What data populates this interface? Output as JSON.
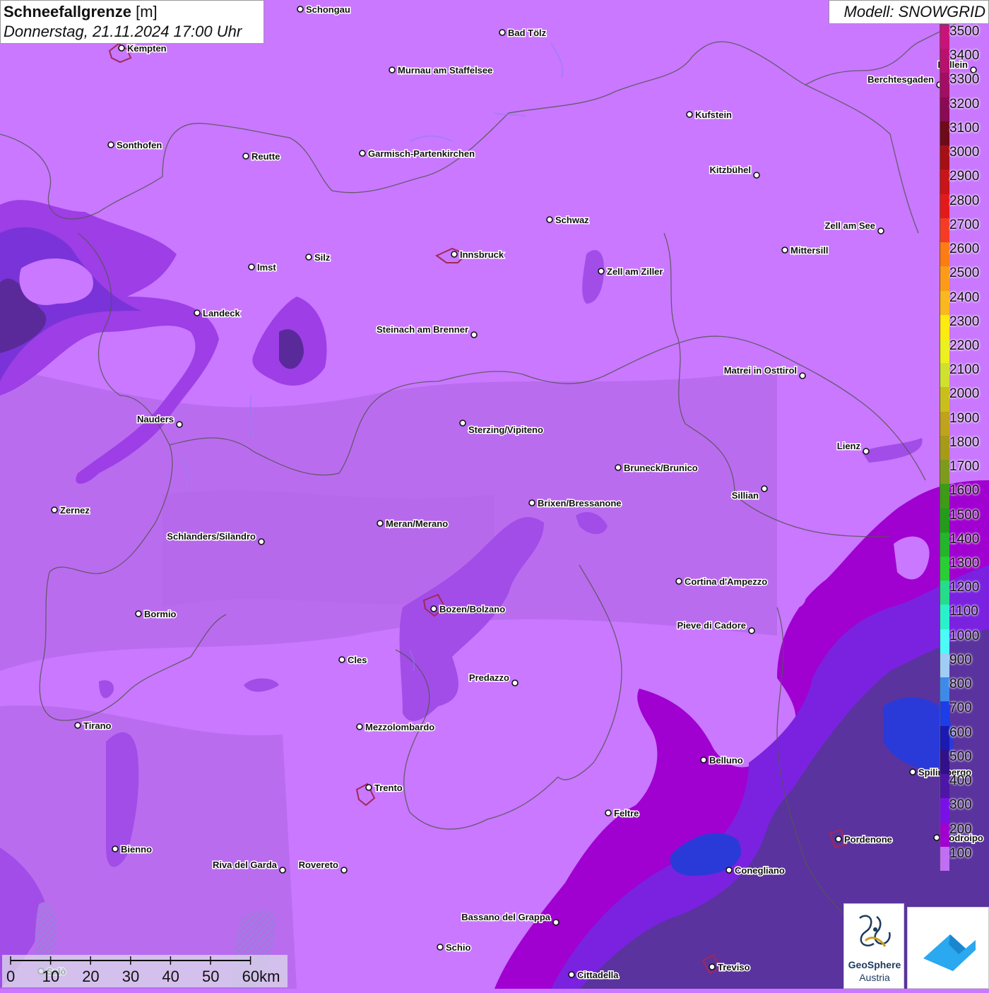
{
  "header": {
    "title_bold": "Schneefallgrenze",
    "title_unit": "[m]",
    "datetime": "Donnerstag, 21.11.2024 17:00 Uhr"
  },
  "model_label": "Modell: SNOWGRID",
  "legend": {
    "labels": [
      "3500",
      "3400",
      "3300",
      "3200",
      "3100",
      "3000",
      "2900",
      "2800",
      "2700",
      "2600",
      "2500",
      "2400",
      "2300",
      "2200",
      "2100",
      "2000",
      "1900",
      "1800",
      "1700",
      "1600",
      "1500",
      "1400",
      "1300",
      "1200",
      "1100",
      "1000",
      "900",
      "800",
      "700",
      "600",
      "500",
      "400",
      "300",
      "200",
      "100"
    ],
    "colors": [
      "#c8137a",
      "#b8116e",
      "#a30d63",
      "#8a0a55",
      "#6e0a1a",
      "#a50f15",
      "#c8141b",
      "#e31a1c",
      "#f53b25",
      "#fe7c14",
      "#fd9a1a",
      "#fbb71e",
      "#fdea10",
      "#ecf01e",
      "#cfe02e",
      "#c9be1c",
      "#c0a21c",
      "#a69a18",
      "#7e9a1c",
      "#3d9b15",
      "#239b1b",
      "#23b52b",
      "#29cd34",
      "#25dc8a",
      "#2af0cc",
      "#4dfafa",
      "#9fcdf5",
      "#3f8ae8",
      "#1c3de8",
      "#1a1ab2",
      "#32108a",
      "#4d16a6",
      "#7a10e8",
      "#a000d0",
      "#c06ef5"
    ]
  },
  "cities": [
    {
      "name": "Schongau"
    },
    {
      "name": "Bad Tölz"
    },
    {
      "name": "Kempten"
    },
    {
      "name": "Murnau am Staffelsee"
    },
    {
      "name": "Hallein"
    },
    {
      "name": "Berchtesgaden"
    },
    {
      "name": "Kufstein"
    },
    {
      "name": "Sonthofen"
    },
    {
      "name": "Reutte"
    },
    {
      "name": "Garmisch-Partenkirchen"
    },
    {
      "name": "Kitzbühel"
    },
    {
      "name": "Schwaz"
    },
    {
      "name": "Zell am See"
    },
    {
      "name": "Innsbruck"
    },
    {
      "name": "Mittersill"
    },
    {
      "name": "Imst"
    },
    {
      "name": "Silz"
    },
    {
      "name": "Zell am Ziller"
    },
    {
      "name": "Landeck"
    },
    {
      "name": "Steinach am Brenner"
    },
    {
      "name": "Matrei in Osttirol"
    },
    {
      "name": "Nauders"
    },
    {
      "name": "Sterzing/Vipiteno"
    },
    {
      "name": "Lienz"
    },
    {
      "name": "Bruneck/Brunico"
    },
    {
      "name": "Sillian"
    },
    {
      "name": "Brixen/Bressanone"
    },
    {
      "name": "Zernez"
    },
    {
      "name": "Meran/Merano"
    },
    {
      "name": "Schlanders/Silandro"
    },
    {
      "name": "Cortina d'Ampezzo"
    },
    {
      "name": "Bozen/Bolzano"
    },
    {
      "name": "Bormio"
    },
    {
      "name": "Pieve di Cadore"
    },
    {
      "name": "Cles"
    },
    {
      "name": "Predazzo"
    },
    {
      "name": "Tirano"
    },
    {
      "name": "Mezzolombardo"
    },
    {
      "name": "Belluno"
    },
    {
      "name": "Spilimbergo"
    },
    {
      "name": "Trento"
    },
    {
      "name": "Feltre"
    },
    {
      "name": "Pordenone"
    },
    {
      "name": "Bienno"
    },
    {
      "name": "Riva del Garda"
    },
    {
      "name": "Rovereto"
    },
    {
      "name": "Conegliano"
    },
    {
      "name": "Bassano del Grappa"
    },
    {
      "name": "Schio"
    },
    {
      "name": "Treviso"
    },
    {
      "name": "Cittadella"
    },
    {
      "name": "Salò"
    },
    {
      "name": "Codroipo"
    }
  ],
  "scale_bar": {
    "labels": [
      "0",
      "10",
      "20",
      "30",
      "40",
      "50",
      "60km"
    ]
  },
  "logo": {
    "line1": "GeoSphere",
    "line2": "Austria"
  }
}
